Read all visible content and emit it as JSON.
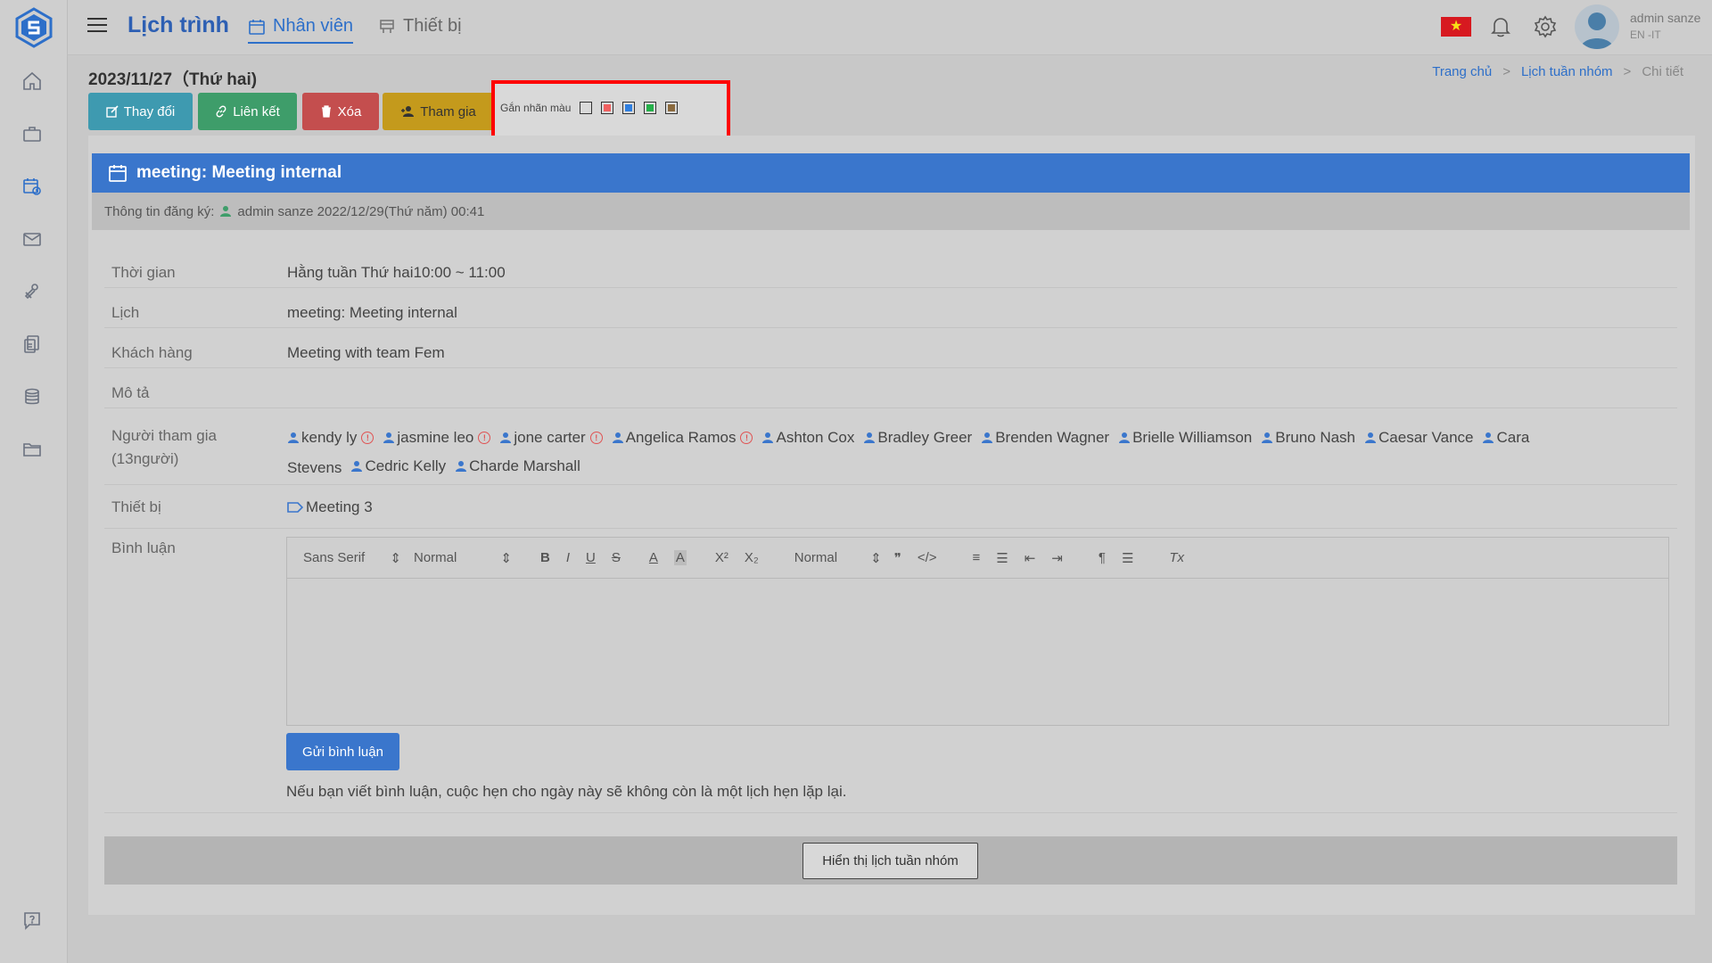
{
  "header": {
    "app_title": "Lịch trình",
    "tabs": [
      {
        "label": "Nhân viên",
        "icon": "calendar-icon",
        "active": true
      },
      {
        "label": "Thiết bị",
        "icon": "equipment-icon",
        "active": false
      }
    ],
    "user": {
      "name": "admin sanze",
      "lang": "EN -IT"
    }
  },
  "page": {
    "date_title": "2023/11/27（Thứ hai)",
    "breadcrumb": [
      "Trang chủ",
      "Lịch tuần nhóm",
      "Chi tiết"
    ],
    "bc_sep": ">"
  },
  "actions": {
    "edit": "Thay đổi",
    "link": "Liên kết",
    "delete": "Xóa",
    "join": "Tham gia"
  },
  "color_tag": {
    "label": "Gắn nhãn màu",
    "colors": [
      "#d9d9d9",
      "#f06060",
      "#2f7fe0",
      "#25b04a",
      "#8b6a3e"
    ]
  },
  "event": {
    "header": "meeting: Meeting internal",
    "reg_label": "Thông tin đăng ký:",
    "reg_value": "admin sanze 2022/12/29(Thứ năm) 00:41",
    "rows": {
      "time_label": "Thời gian",
      "time_value": "Hằng tuần Thứ hai10:00 ~ 11:00",
      "calendar_label": "Lịch",
      "calendar_value": "meeting: Meeting internal",
      "customer_label": "Khách hàng",
      "customer_value": "Meeting with team Fem",
      "desc_label": "Mô tả",
      "participants_label": "Người tham gia",
      "participants_count": "(13người)",
      "equipment_label": "Thiết bị",
      "equipment_value": "Meeting 3",
      "comment_label": "Bình luận"
    },
    "participants_line1": [
      {
        "name": "kendy ly",
        "warn": true
      },
      {
        "name": "jasmine leo",
        "warn": true
      },
      {
        "name": "jone carter",
        "warn": true
      },
      {
        "name": "Angelica Ramos",
        "warn": true
      },
      {
        "name": "Ashton Cox",
        "warn": false
      },
      {
        "name": "Bradley Greer",
        "warn": false
      },
      {
        "name": "Brenden Wagner",
        "warn": false
      },
      {
        "name": "Brielle Williamson",
        "warn": false
      },
      {
        "name": "Bruno Nash",
        "warn": false
      },
      {
        "name": "Caesar Vance",
        "warn": false
      },
      {
        "name": "Cara",
        "warn": false
      }
    ],
    "participants_line2": [
      {
        "name": "Stevens",
        "icon": false
      },
      {
        "name": "Cedric Kelly",
        "icon": true
      },
      {
        "name": "Charde Marshall",
        "icon": true
      }
    ]
  },
  "editor": {
    "font": "Sans Serif",
    "size": "Normal",
    "heading": "Normal",
    "send_label": "Gửi bình luận",
    "note": "Nếu bạn viết bình luận, cuộc hẹn cho ngày này sẽ không còn là một lịch hẹn lặp lại."
  },
  "footer": {
    "show_label": "Hiển thị lịch tuần nhóm"
  }
}
